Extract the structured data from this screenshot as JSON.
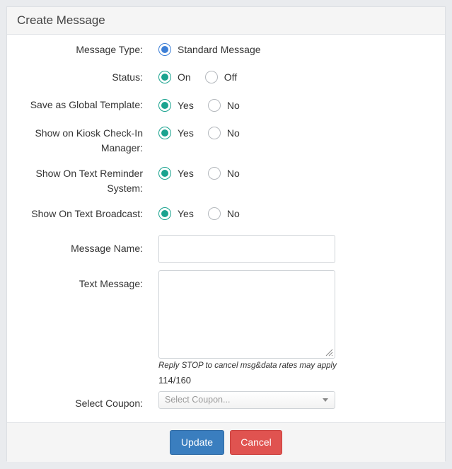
{
  "header": {
    "title": "Create Message"
  },
  "form": {
    "message_type": {
      "label": "Message Type:",
      "options": [
        "Standard Message"
      ]
    },
    "status": {
      "label": "Status:",
      "options": [
        "On",
        "Off"
      ]
    },
    "global_template": {
      "label": "Save as Global Template:",
      "options": [
        "Yes",
        "No"
      ]
    },
    "kiosk": {
      "label_line1": "Show on Kiosk Check-In",
      "label_line2": "Manager:",
      "options": [
        "Yes",
        "No"
      ]
    },
    "text_reminder": {
      "label_line1": "Show On Text Reminder",
      "label_line2": "System:",
      "options": [
        "Yes",
        "No"
      ]
    },
    "text_broadcast": {
      "label": "Show On Text Broadcast:",
      "options": [
        "Yes",
        "No"
      ]
    },
    "message_name": {
      "label": "Message Name:",
      "value": ""
    },
    "text_message": {
      "label": "Text Message:",
      "value": "",
      "hint": "Reply STOP to cancel msg&data rates may apply",
      "counter": "114/160"
    },
    "coupon": {
      "label": "Select Coupon:",
      "placeholder": "Select Coupon..."
    }
  },
  "footer": {
    "update_label": "Update",
    "cancel_label": "Cancel"
  },
  "colors": {
    "primary": "#3a7ebf",
    "danger": "#e05350",
    "radio_blue": "#3d7fd6",
    "radio_teal": "#1aa38f"
  }
}
